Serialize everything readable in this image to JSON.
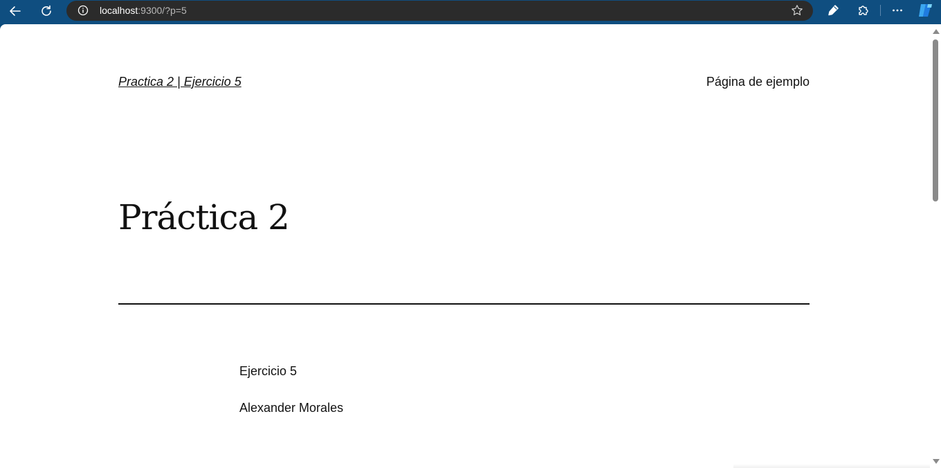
{
  "browser": {
    "url_host": "localhost",
    "url_rest": ":9300/?p=5",
    "icons": {
      "back": "back-arrow-icon",
      "reload": "reload-icon",
      "info": "info-icon",
      "favorite": "star-icon",
      "pen": "pen-icon",
      "extensions": "puzzle-icon",
      "menu": "more-icon",
      "copilot": "copilot-icon"
    },
    "colors": {
      "chrome": "#0f4e80",
      "address_bar": "#2b2b2b"
    }
  },
  "page": {
    "site_title": "Practica 2 | Ejercicio 5",
    "nav_link": "Página de ejemplo",
    "title": "Práctica 2",
    "paragraphs": [
      "Ejercicio 5",
      "Alexander Morales"
    ]
  }
}
